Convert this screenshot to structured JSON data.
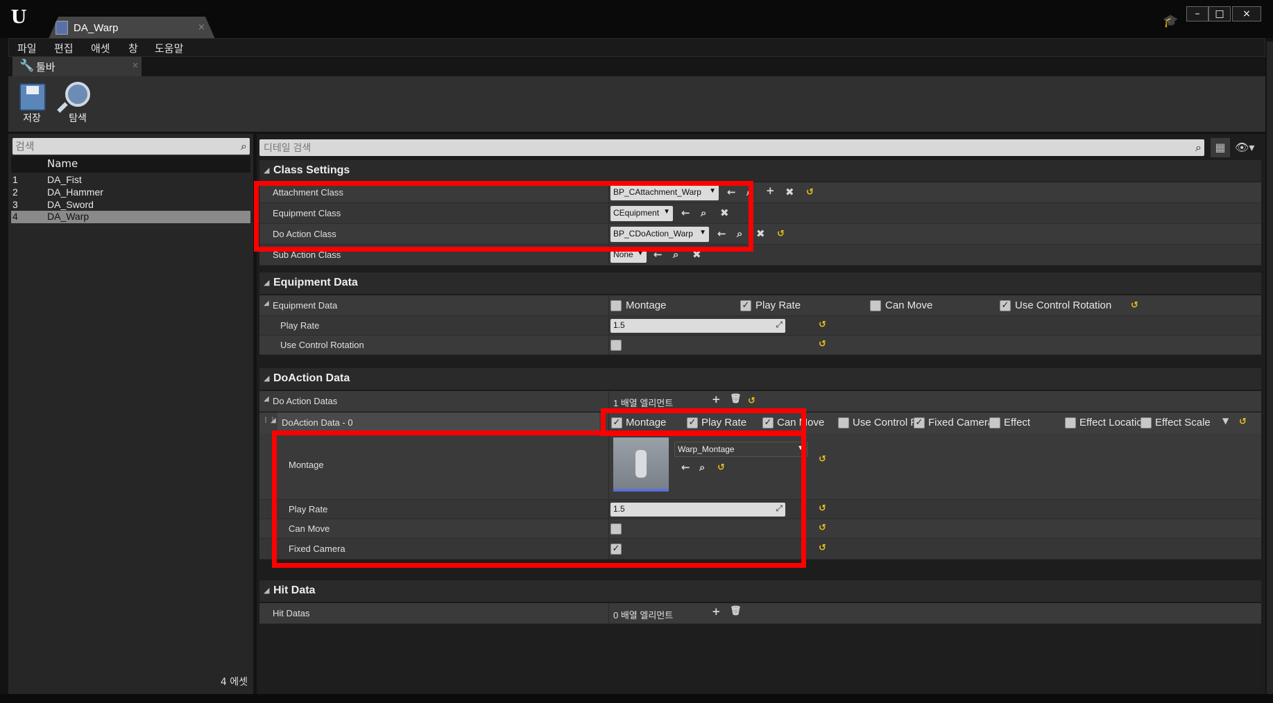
{
  "window": {
    "tab_title": "DA_Warp",
    "tab_close": "×",
    "buttons": {
      "minimize": "–",
      "maximize": "□",
      "close": "×"
    }
  },
  "menu": [
    "파일",
    "편집",
    "애셋",
    "창",
    "도움말"
  ],
  "toolbar_tab": {
    "label": "툴바",
    "close": "×"
  },
  "toolbar": {
    "save": "저장",
    "browse": "탐색"
  },
  "left": {
    "search_placeholder": "검색",
    "column_header": "Name",
    "rows": [
      {
        "n": "1",
        "name": "DA_Fist"
      },
      {
        "n": "2",
        "name": "DA_Hammer"
      },
      {
        "n": "3",
        "name": "DA_Sword"
      },
      {
        "n": "4",
        "name": "DA_Warp"
      }
    ],
    "selected_index": 3,
    "count": "4 에셋"
  },
  "details": {
    "search_placeholder": "디테일 검색",
    "class_settings": {
      "title": "Class Settings",
      "attachment": {
        "label": "Attachment Class",
        "value": "BP_CAttachment_Warp"
      },
      "equipment": {
        "label": "Equipment Class",
        "value": "CEquipment"
      },
      "doaction": {
        "label": "Do Action Class",
        "value": "BP_CDoAction_Warp"
      },
      "subaction": {
        "label": "Sub Action Class",
        "value": "None"
      }
    },
    "equipment_data": {
      "title": "Equipment Data",
      "header": "Equipment Data",
      "flags": [
        {
          "label": "Montage",
          "checked": false
        },
        {
          "label": "Play Rate",
          "checked": true
        },
        {
          "label": "Can Move",
          "checked": false
        },
        {
          "label": "Use Control Rotation",
          "checked": true
        }
      ],
      "play_rate": {
        "label": "Play Rate",
        "value": "1.5"
      },
      "use_control_rotation": {
        "label": "Use Control Rotation",
        "checked": false
      }
    },
    "doaction_data": {
      "title": "DoAction Data",
      "datas_label": "Do Action Datas",
      "datas_count": "1 배열 엘리먼트",
      "element": {
        "label": "DoAction Data - 0",
        "flags": [
          {
            "label": "Montage",
            "checked": true
          },
          {
            "label": "Play Rate",
            "checked": true
          },
          {
            "label": "Can Move",
            "checked": true
          },
          {
            "label": "Use Control Rotation",
            "checked": false
          },
          {
            "label": "Fixed Camera",
            "checked": true
          },
          {
            "label": "Effect",
            "checked": false
          },
          {
            "label": "Effect Location",
            "checked": false
          },
          {
            "label": "Effect Scale",
            "checked": false
          }
        ],
        "montage": {
          "label": "Montage",
          "value": "Warp_Montage"
        },
        "play_rate": {
          "label": "Play Rate",
          "value": "1.5"
        },
        "can_move": {
          "label": "Can Move",
          "checked": false
        },
        "fixed_camera": {
          "label": "Fixed Camera",
          "checked": true
        }
      }
    },
    "hit_data": {
      "title": "Hit Data",
      "datas_label": "Hit Datas",
      "datas_count": "0 배열 엘리먼트"
    }
  },
  "icons": {
    "back": "←",
    "find": "⌕",
    "add": "+",
    "clear": "✖",
    "reset": "↺",
    "delete": "🗑",
    "dropdown": "▾",
    "expand": "◢",
    "check": "✓"
  }
}
